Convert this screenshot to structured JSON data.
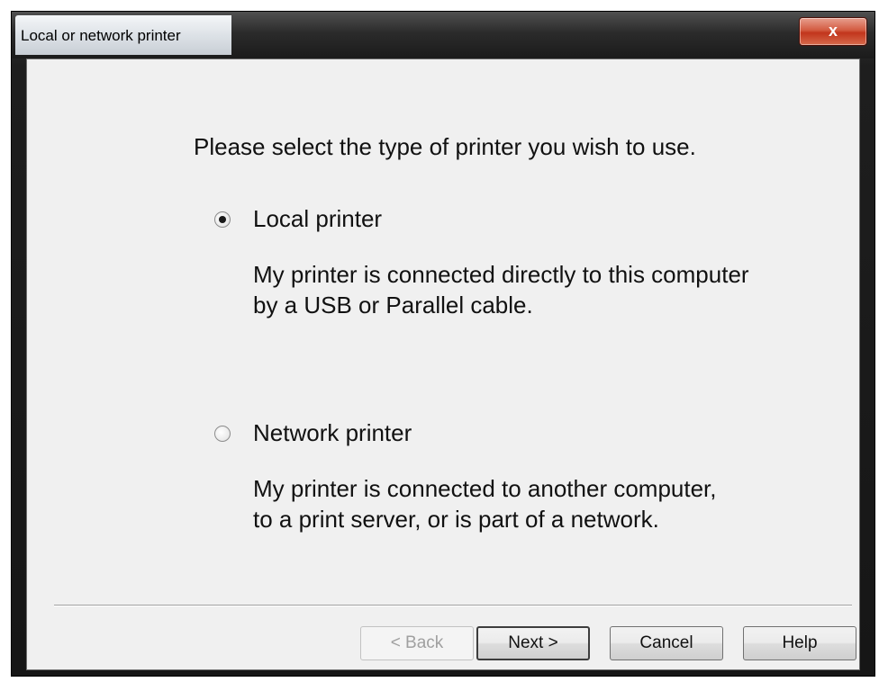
{
  "window": {
    "title": "Local or network printer",
    "close_label": "x"
  },
  "prompt": "Please select the type of printer you wish to use.",
  "options": [
    {
      "label": "Local printer",
      "checked": true,
      "desc_line1": "My printer is connected directly to this computer",
      "desc_line2": "by a USB or Parallel cable."
    },
    {
      "label": "Network printer",
      "checked": false,
      "desc_line1": "My printer is connected to another computer,",
      "desc_line2": "to a print server, or is part of a network."
    }
  ],
  "buttons": {
    "back": "< Back",
    "next": "Next >",
    "cancel": "Cancel",
    "help": "Help"
  },
  "colors": {
    "close_button": "#c2351c",
    "dialog_background": "#f0f0f0",
    "frame": "#1e1e1e"
  }
}
